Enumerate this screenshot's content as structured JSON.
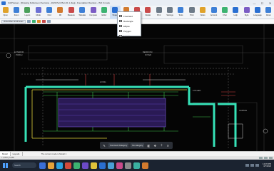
{
  "window": {
    "title": "CADViewer - [Drawing Fullscreen Overview - 2023 Part Plan 01 1.dwg] - Foundation Revision - ISO 3 mode",
    "minimize": "—",
    "maximize": "☐",
    "close": "✕"
  },
  "toolbar": {
    "items": [
      {
        "label": "Open",
        "icon": "folder-icon",
        "color": "#e0a22a"
      },
      {
        "label": "Zoom",
        "icon": "zoom-icon",
        "color": "#3d7fd6"
      },
      {
        "label": "Layers",
        "icon": "layers-icon",
        "color": "#4a9f5a"
      },
      {
        "label": "Mode",
        "icon": "mode-icon",
        "color": "#6b6fd4"
      },
      {
        "label": "Find",
        "icon": "search-icon",
        "color": "#3d7fd6"
      },
      {
        "label": "3D",
        "icon": "cube-icon",
        "color": "#d27a2e"
      },
      {
        "label": "Measure",
        "icon": "ruler-icon",
        "color": "#c94a4a"
      },
      {
        "label": "Tabulate",
        "icon": "table-icon",
        "color": "#3d7fd6"
      },
      {
        "label": "Compare",
        "icon": "compare-icon",
        "color": "#7b5cc4"
      },
      {
        "label": "Editor",
        "icon": "edit-icon",
        "color": "#3cb371"
      },
      {
        "label": "Shape",
        "icon": "shape-icon",
        "color": "#2a6fd1"
      },
      {
        "label": "Line",
        "icon": "line-icon",
        "color": "#d27a2e"
      },
      {
        "label": "Freehand",
        "icon": "pen-icon",
        "color": "#c94a4a"
      },
      {
        "label": "Delete",
        "icon": "delete-icon",
        "color": "#c94a4a"
      },
      {
        "label": "Print",
        "icon": "print-icon",
        "color": "#6d7a88"
      },
      {
        "label": "Settings",
        "icon": "gear-icon",
        "color": "#6d7a88"
      },
      {
        "label": "Tools",
        "icon": "tools-icon",
        "color": "#3d7fd6"
      },
      {
        "label": "Print",
        "icon": "print-icon",
        "color": "#6d7a88"
      },
      {
        "label": "Notes",
        "icon": "notes-icon",
        "color": "#e0a22a"
      },
      {
        "label": "Account",
        "icon": "user-icon",
        "color": "#3d7fd6"
      },
      {
        "label": "Chat",
        "icon": "chat-icon",
        "color": "#3cb371"
      },
      {
        "label": "Help",
        "icon": "help-icon",
        "color": "#2a6fd1"
      },
      {
        "label": "Style",
        "icon": "style-icon",
        "color": "#7b5cc4"
      },
      {
        "label": "Language",
        "icon": "globe-icon",
        "color": "#2a6fd1"
      },
      {
        "label": "About",
        "icon": "info-icon",
        "color": "#3d7fd6"
      }
    ]
  },
  "subbar": {
    "tab_label": "2D Ed Plan 02 All Areas"
  },
  "shape_menu": {
    "items": [
      {
        "label": "Freehand",
        "swatch": "#ffffff"
      },
      {
        "label": "Rectangle",
        "swatch": "#ffffff"
      },
      {
        "label": "Ellipse",
        "swatch": "#ffffff"
      },
      {
        "label": "Polygon",
        "swatch": "#ffffff"
      },
      {
        "label": "Leader",
        "swatch": "#ffffff"
      }
    ]
  },
  "canvas": {
    "labels": [
      "EXTERIOR",
      "PORCH",
      "BEDROOM",
      "FOYER",
      "LIVING",
      "KITCHEN",
      "GARAGE"
    ],
    "accent": "#36e2b8"
  },
  "float_toolbar": {
    "category": "Comment Category",
    "subcategory": "No category"
  },
  "bottom": {
    "tabs": [
      "Model",
      "Layout1"
    ],
    "command": "The current mode is Model 1"
  },
  "status": {
    "coords": "x 1,994 y 6,958"
  },
  "taskbar": {
    "search": "Search",
    "time": "12:45 PM",
    "date": "4/7/2024"
  }
}
